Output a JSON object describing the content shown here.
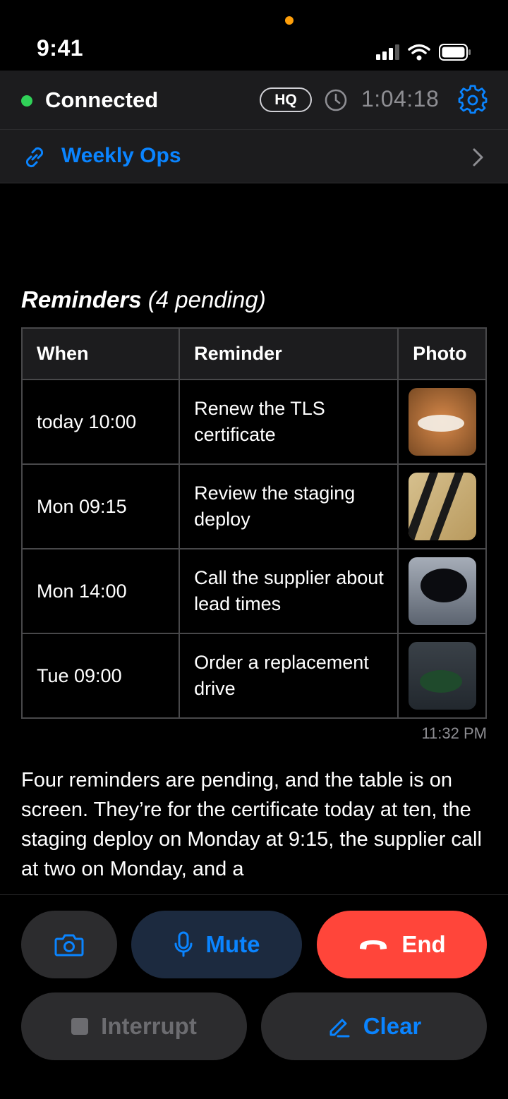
{
  "status_bar": {
    "time": "9:41"
  },
  "header": {
    "connection_label": "Connected",
    "location_badge": "HQ",
    "call_timer": "1:04:18"
  },
  "linked_item": {
    "label": "Weekly Ops"
  },
  "reminders": {
    "title": "Reminders",
    "count_label": "(4 pending)",
    "columns": [
      "When",
      "Reminder",
      "Photo"
    ],
    "rows": [
      {
        "when": "today 10:00",
        "reminder": "Renew the TLS certificate"
      },
      {
        "when": "Mon 09:15",
        "reminder": "Review the staging deploy"
      },
      {
        "when": "Mon 14:00",
        "reminder": "Call the supplier about lead times"
      },
      {
        "when": "Tue 09:00",
        "reminder": "Order a replacement drive"
      }
    ]
  },
  "message_time": "11:32 PM",
  "reply_text": "Four reminders are pending, and the table is on screen. They’re for the certificate today at ten, the staging deploy on Monday at 9:15, the supplier call at two on Monday, and a",
  "controls": {
    "mute_label": "Mute",
    "end_label": "End",
    "interrupt_label": "Interrupt",
    "clear_label": "Clear"
  },
  "colors": {
    "accent": "#0a84ff",
    "end": "#ff453a",
    "connected": "#30d158",
    "recording_dot": "#ff9f0a"
  }
}
